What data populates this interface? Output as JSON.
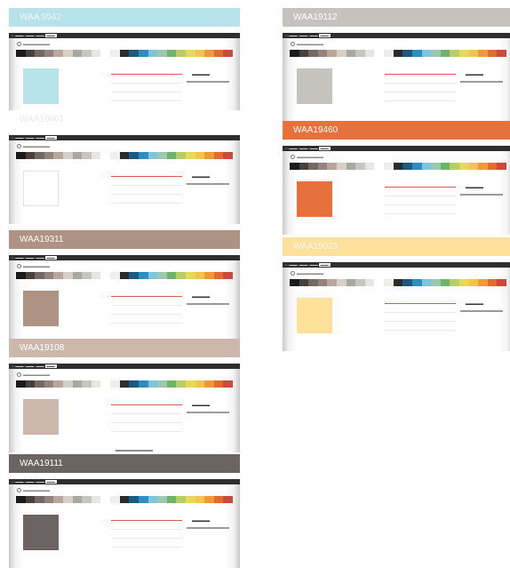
{
  "palette": [
    "#1a1a1a",
    "#4a3f3b",
    "#746862",
    "#92847d",
    "#b9a79c",
    "#d8cfc6",
    "#a9a7a1",
    "#c7c5bf",
    "#e8e6e1",
    "#ffffff",
    "#f0eeea",
    "#2b2b2b",
    "#1e5a7e",
    "#2f8ec0",
    "#7ec4dc",
    "#9ec7b2",
    "#6db36b",
    "#b4cf6a",
    "#e8d85a",
    "#f2c54a",
    "#ef9a3a",
    "#e36b32",
    "#c94a3a"
  ],
  "cards": [
    {
      "id": "card-1",
      "code": "WAA 9542",
      "header_color": "#b8e3eb",
      "swatch_color": "#b8e3eb"
    },
    {
      "id": "card-2",
      "code": "WAA19112",
      "header_color": "#c5c3bd",
      "swatch_color": "#c5c3bd"
    },
    {
      "id": "card-3",
      "code": "WAA19001",
      "header_color": "#ffffff",
      "swatch_color": "#ffffff"
    },
    {
      "id": "card-4",
      "code": "WAA19460",
      "header_color": "#e8703c",
      "swatch_color": "#e8703c"
    },
    {
      "id": "card-5",
      "code": "WAA19311",
      "header_color": "#ae9283",
      "swatch_color": "#ae9283"
    },
    {
      "id": "card-6",
      "code": "WAA19023",
      "header_color": "#fde19a",
      "swatch_color": "#fde19a"
    },
    {
      "id": "card-7",
      "code": "WAA19108",
      "header_color": "#cdb7ad",
      "swatch_color": "#cdb7ad"
    },
    {
      "id": "card-8",
      "code": "WAA19111",
      "header_color": "#6c6363",
      "swatch_color": "#6c6363"
    }
  ]
}
